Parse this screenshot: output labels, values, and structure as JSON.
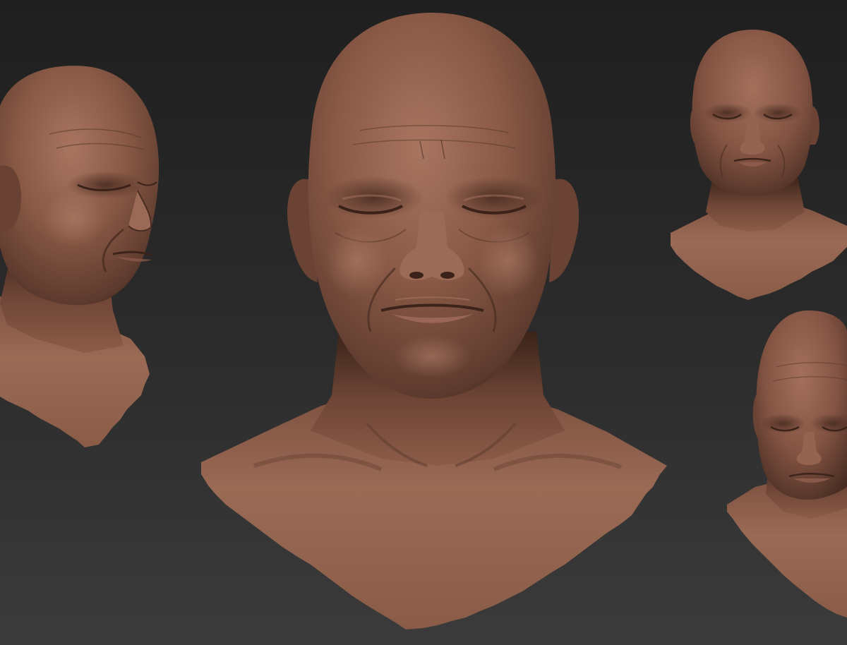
{
  "scene": {
    "background_top": "#222222",
    "background_mid": "#2d2d2d",
    "background_bottom": "#3a3a3a",
    "skin_base": "#8a5a46",
    "skin_highlight": "#b07a62",
    "skin_shadow": "#3e261d",
    "lip_color": "#9a6658"
  },
  "renders": [
    {
      "view": "three-quarter-left"
    },
    {
      "view": "front"
    },
    {
      "view": "front-small"
    },
    {
      "view": "front-small-cropped"
    }
  ]
}
